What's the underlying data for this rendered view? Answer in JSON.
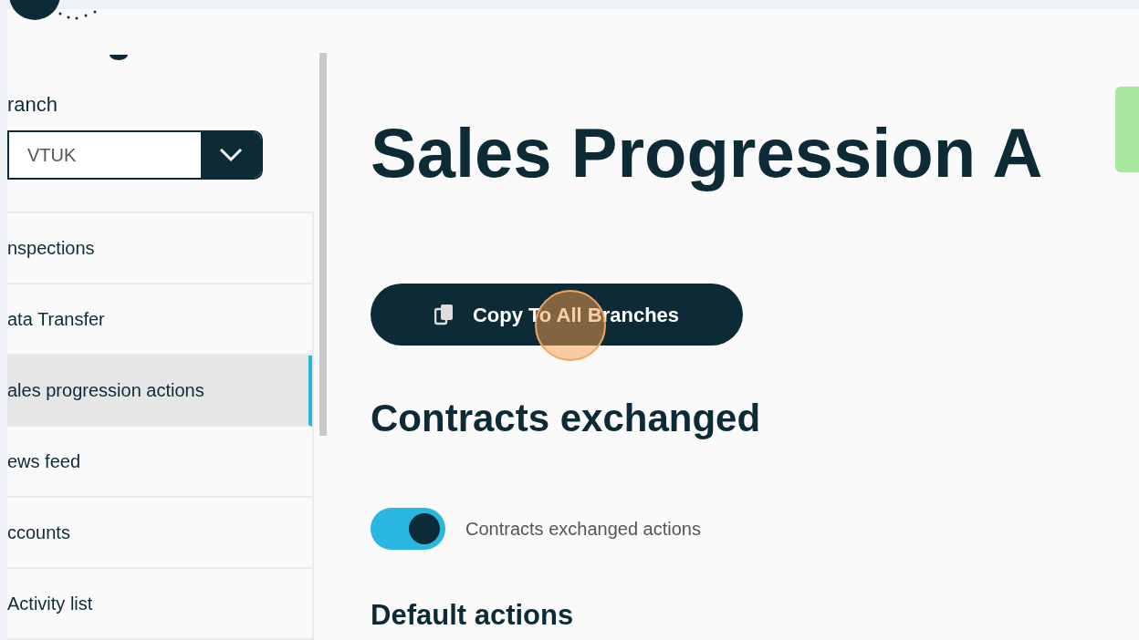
{
  "sidebar": {
    "branch_label": "ranch",
    "branch_select": {
      "value": "VTUK"
    },
    "items": [
      {
        "label": "nspections",
        "selected": false
      },
      {
        "label": "ata Transfer",
        "selected": false
      },
      {
        "label": "ales progression actions",
        "selected": true
      },
      {
        "label": "ews feed",
        "selected": false
      },
      {
        "label": "ccounts",
        "selected": false
      },
      {
        "label": "Activity list",
        "selected": false
      }
    ]
  },
  "main": {
    "title": "Sales Progression A",
    "copy_button": "Copy To All Branches",
    "section_title": "Contracts exchanged",
    "toggle": {
      "label": "Contracts exchanged actions",
      "on": true
    },
    "subsection_title": "Default actions"
  }
}
